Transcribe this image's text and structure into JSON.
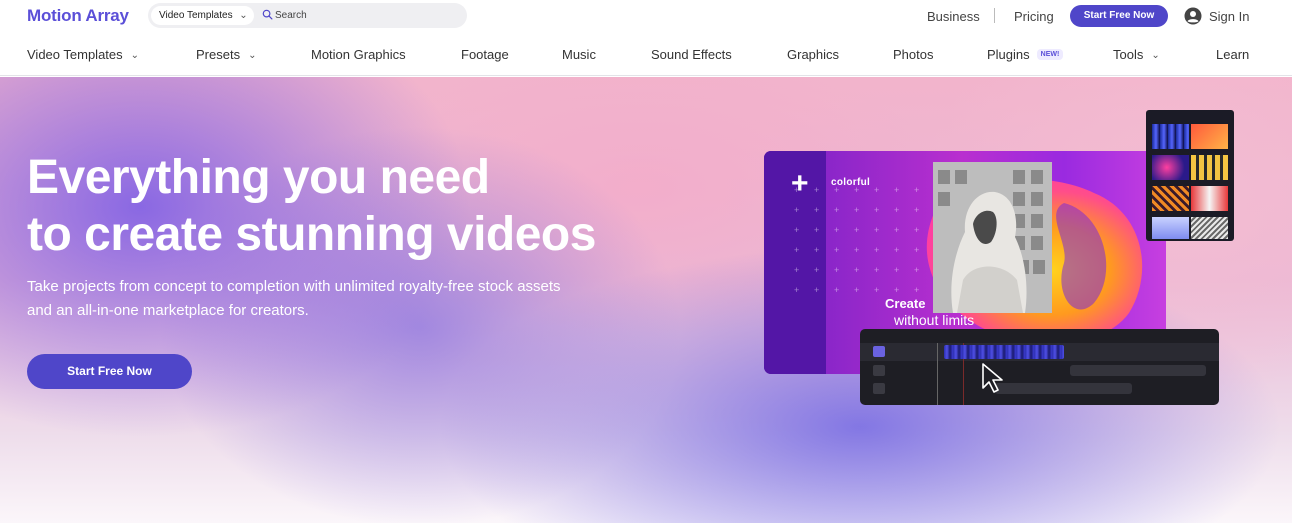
{
  "header": {
    "logo": "Motion Array",
    "search": {
      "category": "Video Templates",
      "placeholder": "Search"
    },
    "links": {
      "business": "Business",
      "pricing": "Pricing",
      "cta": "Start Free Now",
      "signin": "Sign In"
    }
  },
  "nav": {
    "items": [
      {
        "label": "Video Templates",
        "dropdown": true
      },
      {
        "label": "Presets",
        "dropdown": true
      },
      {
        "label": "Motion Graphics"
      },
      {
        "label": "Footage"
      },
      {
        "label": "Music"
      },
      {
        "label": "Sound Effects"
      },
      {
        "label": "Graphics"
      },
      {
        "label": "Photos"
      },
      {
        "label": "Plugins",
        "badge": "NEW!"
      },
      {
        "label": "Tools",
        "dropdown": true
      },
      {
        "label": "Learn"
      }
    ]
  },
  "hero": {
    "title_line1": "Everything you need",
    "title_line2": "to create stunning videos",
    "subtitle_line1": "Take projects from concept to completion with unlimited royalty-free stock assets",
    "subtitle_line2": "and an all-in-one marketplace for creators.",
    "cta": "Start Free Now",
    "mockup": {
      "label": "colorful",
      "headline": "Create",
      "tagline": "without limits"
    }
  },
  "colors": {
    "brand": "#5b4fd8",
    "button": "#4f46c9",
    "badge_bg": "#eeebff"
  },
  "icons": {
    "search": "search-icon",
    "user": "user-icon",
    "chevron": "chevron-down-icon",
    "cursor": "cursor-icon",
    "plus": "plus-icon"
  }
}
